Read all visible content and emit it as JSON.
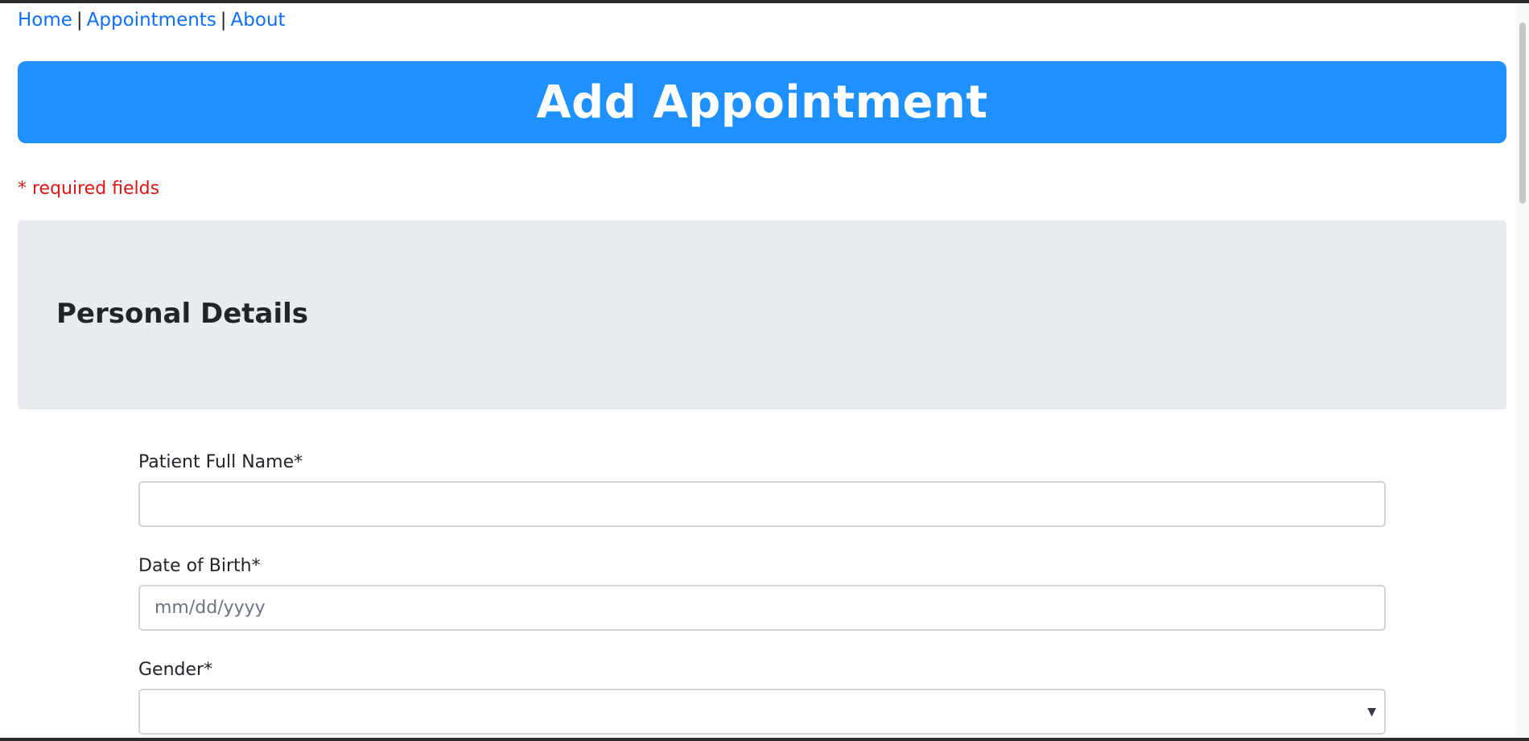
{
  "nav": {
    "home": "Home",
    "separator": "|",
    "appointments": "Appointments",
    "about": "About"
  },
  "header": {
    "title": "Add Appointment"
  },
  "required_note": "* required fields",
  "section": {
    "title": "Personal Details"
  },
  "form": {
    "full_name": {
      "label": "Patient Full Name*",
      "value": ""
    },
    "dob": {
      "label": "Date of Birth*",
      "placeholder": "mm/dd/yyyy"
    },
    "gender": {
      "label": "Gender*",
      "value": ""
    }
  },
  "colors": {
    "banner": "#1e90ff",
    "link": "#0d6efd",
    "required": "#dc1414",
    "section_bg": "#e9ecef"
  },
  "icons": {
    "select_arrow": "chevron-down-icon"
  }
}
